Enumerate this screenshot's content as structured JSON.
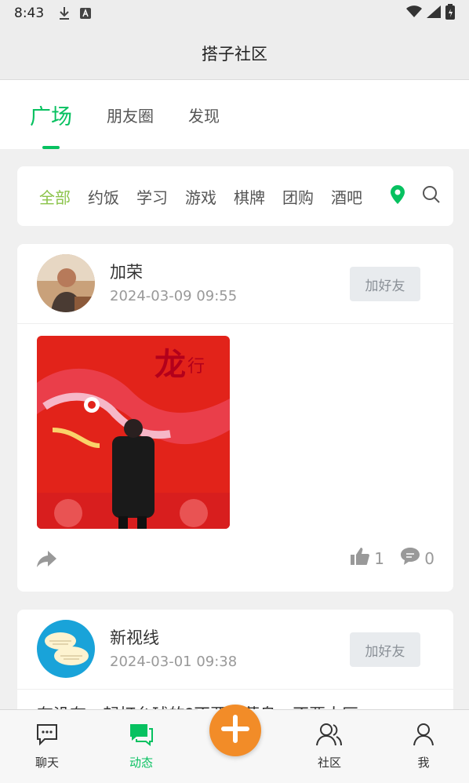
{
  "status_bar": {
    "time": "8:43"
  },
  "header": {
    "title": "搭子社区"
  },
  "tabs": [
    {
      "label": "广场",
      "active": true
    },
    {
      "label": "朋友圈",
      "active": false
    },
    {
      "label": "发现",
      "active": false
    }
  ],
  "categories": [
    {
      "label": "全部",
      "active": true
    },
    {
      "label": "约饭"
    },
    {
      "label": "学习"
    },
    {
      "label": "游戏"
    },
    {
      "label": "棋牌"
    },
    {
      "label": "团购"
    },
    {
      "label": "酒吧"
    }
  ],
  "posts": [
    {
      "user": "加荣",
      "time": "2024-03-09 09:55",
      "add_friend_label": "加好友",
      "likes": "1",
      "comments": "0"
    },
    {
      "user": "新视线",
      "time": "2024-03-01 09:38",
      "add_friend_label": "加好友",
      "text": "有没有一起打台球的?不要大菜鸟，不要大区"
    }
  ],
  "bottom_nav": [
    {
      "label": "聊天",
      "icon": "chat-icon"
    },
    {
      "label": "动态",
      "icon": "moments-icon",
      "active": true
    },
    {
      "label": "社区",
      "icon": "community-icon"
    },
    {
      "label": "我",
      "icon": "profile-icon"
    }
  ],
  "colors": {
    "accent": "#07c160",
    "category_active": "#8bc34a",
    "fab": "#f28c28"
  }
}
